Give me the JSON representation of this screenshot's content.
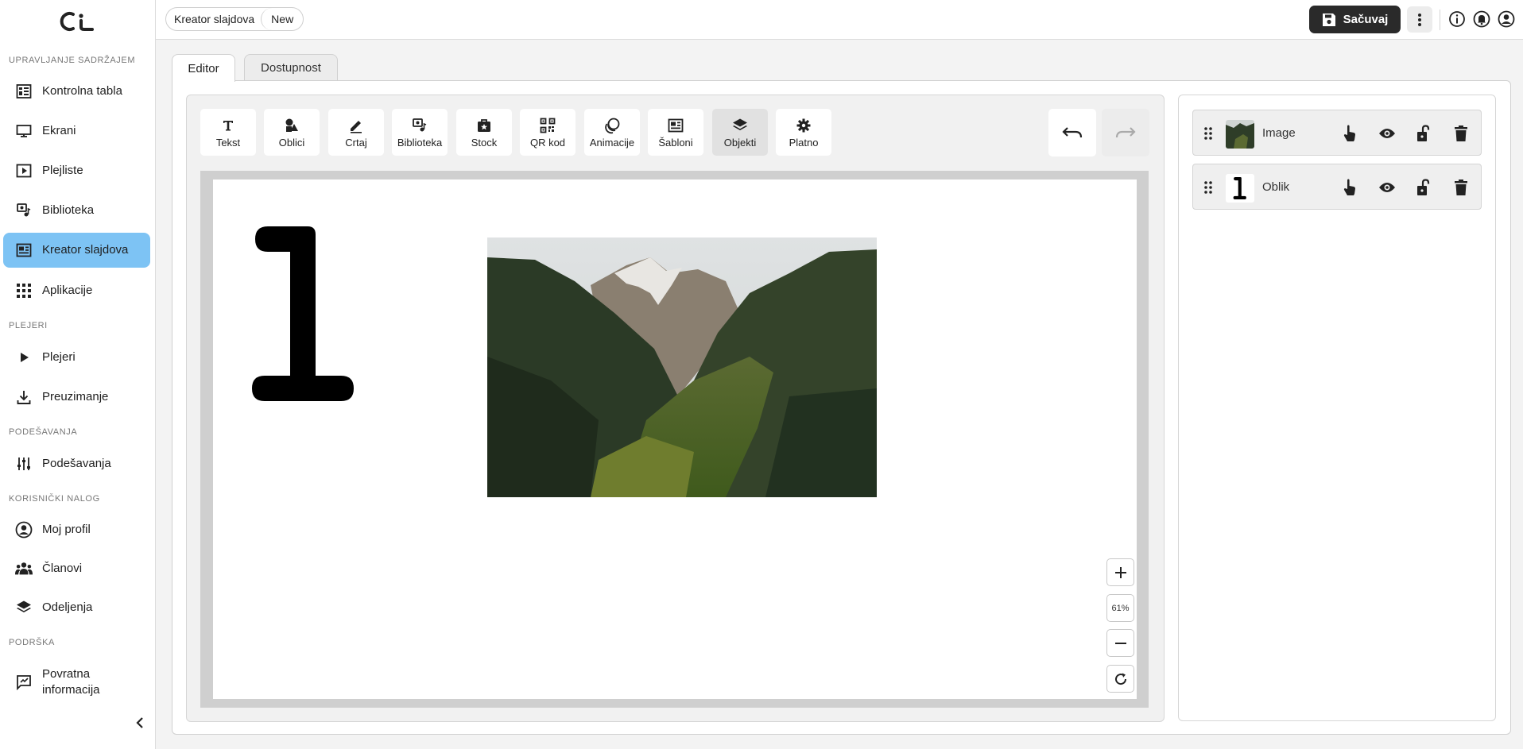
{
  "sidebar": {
    "sections": [
      {
        "title": "UPRAVLJANJE SADRŽAJEM",
        "items": [
          {
            "label": "Kontrolna tabla",
            "icon": "dashboard-icon"
          },
          {
            "label": "Ekrani",
            "icon": "monitor-icon"
          },
          {
            "label": "Plejliste",
            "icon": "playlist-icon"
          },
          {
            "label": "Biblioteka",
            "icon": "library-icon"
          },
          {
            "label": "Kreator slajdova",
            "icon": "slide-creator-icon",
            "active": true
          },
          {
            "label": "Aplikacije",
            "icon": "apps-grid-icon"
          }
        ]
      },
      {
        "title": "PLEJERI",
        "items": [
          {
            "label": "Plejeri",
            "icon": "play-icon"
          },
          {
            "label": "Preuzimanje",
            "icon": "download-icon"
          }
        ]
      },
      {
        "title": "PODEŠAVANJA",
        "items": [
          {
            "label": "Podešavanja",
            "icon": "sliders-icon"
          }
        ]
      },
      {
        "title": "KORISNIČKI NALOG",
        "items": [
          {
            "label": "Moj profil",
            "icon": "profile-icon"
          },
          {
            "label": "Članovi",
            "icon": "members-icon"
          },
          {
            "label": "Odeljenja",
            "icon": "layers-icon"
          }
        ]
      },
      {
        "title": "PODRŠKA",
        "items": [
          {
            "label": "Povratna informacija",
            "icon": "feedback-icon"
          }
        ]
      }
    ]
  },
  "topbar": {
    "breadcrumb": [
      "Kreator slajdova",
      "New"
    ],
    "save_label": "Sačuvaj"
  },
  "tabs": [
    "Editor",
    "Dostupnost"
  ],
  "active_tab": "Editor",
  "toolbar": {
    "tools": [
      {
        "label": "Tekst",
        "icon": "text-icon"
      },
      {
        "label": "Oblici",
        "icon": "shapes-icon"
      },
      {
        "label": "Crtaj",
        "icon": "pen-icon"
      },
      {
        "label": "Biblioteka",
        "icon": "library-icon"
      },
      {
        "label": "Stock",
        "icon": "stock-bag-icon"
      },
      {
        "label": "QR kod",
        "icon": "qr-code-icon"
      },
      {
        "label": "Animacije",
        "icon": "animation-icon"
      },
      {
        "label": "Šabloni",
        "icon": "template-icon"
      },
      {
        "label": "Objekti",
        "icon": "layers-icon",
        "active": true
      },
      {
        "label": "Platno",
        "icon": "gear-icon"
      }
    ]
  },
  "canvas": {
    "zoom": "61%",
    "shape_glyph": "1"
  },
  "layers": [
    {
      "name": "Image",
      "thumb": "image"
    },
    {
      "name": "Oblik",
      "thumb": "1"
    }
  ],
  "colors": {
    "accent": "#7dc3f4",
    "dark_button": "#2a2a2a"
  }
}
